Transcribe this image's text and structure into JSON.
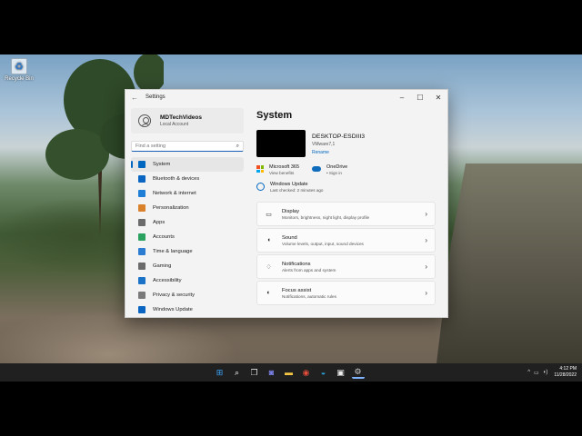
{
  "desktop": {
    "recycle_bin_label": "Recycle Bin"
  },
  "window": {
    "title": "Settings",
    "controls": {
      "minimize": "–",
      "maximize": "☐",
      "close": "✕"
    }
  },
  "sidebar": {
    "profile": {
      "name": "MDTechVideos",
      "subtitle": "Local Account"
    },
    "search_placeholder": "Find a setting",
    "items": [
      {
        "label": "System",
        "icon": "monitor-icon",
        "color": "#0067c0",
        "active": true
      },
      {
        "label": "Bluetooth & devices",
        "icon": "bluetooth-icon",
        "color": "#0a66c2"
      },
      {
        "label": "Network & internet",
        "icon": "wifi-icon",
        "color": "#1f7fd6"
      },
      {
        "label": "Personalization",
        "icon": "brush-icon",
        "color": "#d9822b"
      },
      {
        "label": "Apps",
        "icon": "apps-icon",
        "color": "#6b6b6b"
      },
      {
        "label": "Accounts",
        "icon": "person-icon",
        "color": "#2ba15f"
      },
      {
        "label": "Time & language",
        "icon": "globe-icon",
        "color": "#2c7cd1"
      },
      {
        "label": "Gaming",
        "icon": "gamepad-icon",
        "color": "#6b6b6b"
      },
      {
        "label": "Accessibility",
        "icon": "accessibility-icon",
        "color": "#1a73c7"
      },
      {
        "label": "Privacy & security",
        "icon": "shield-icon",
        "color": "#7a7a7a"
      },
      {
        "label": "Windows Update",
        "icon": "update-icon",
        "color": "#0a64c2"
      }
    ]
  },
  "main": {
    "page_title": "System",
    "device": {
      "name": "DESKTOP-ESDIII3",
      "model": "VMware7,1",
      "rename_link": "Rename"
    },
    "quick": [
      {
        "title": "Microsoft 365",
        "subtitle": "View benefits"
      },
      {
        "title": "OneDrive",
        "subtitle": "• Sign in"
      }
    ],
    "windows_update": {
      "title": "Windows Update",
      "subtitle": "Last checked: 2 minutes ago"
    },
    "cards": [
      {
        "title": "Display",
        "subtitle": "Monitors, brightness, night light, display profile",
        "icon": "display-icon"
      },
      {
        "title": "Sound",
        "subtitle": "Volume levels, output, input, sound devices",
        "icon": "speaker-icon"
      },
      {
        "title": "Notifications",
        "subtitle": "Alerts from apps and system",
        "icon": "bell-icon"
      },
      {
        "title": "Focus assist",
        "subtitle": "Notifications, automatic rules",
        "icon": "moon-icon"
      }
    ]
  },
  "taskbar": {
    "apps": [
      "start-icon",
      "search-icon",
      "task-view-icon",
      "chat-icon",
      "file-explorer-icon",
      "chrome-icon",
      "edge-icon",
      "store-icon",
      "settings-icon"
    ],
    "clock": {
      "time": "4:12 PM",
      "date": "11/28/2022"
    }
  }
}
